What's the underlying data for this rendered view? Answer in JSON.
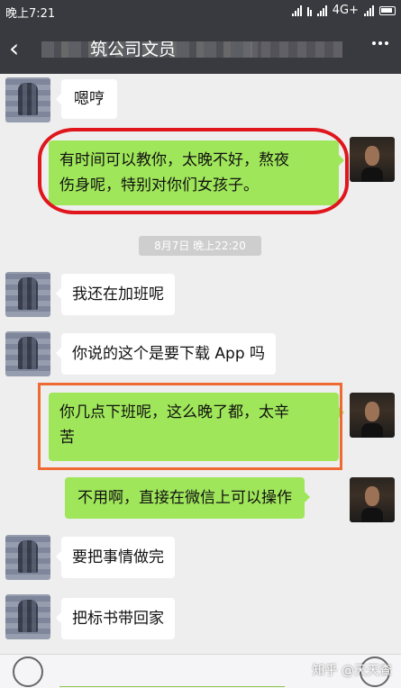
{
  "status_bar": {
    "time": "晚上7:21",
    "network": "4G+"
  },
  "nav": {
    "title": "筑公司文员",
    "back_icon": "chevron-left-icon",
    "more_icon": "more-icon"
  },
  "messages": [
    {
      "side": "in",
      "text": "嗯哼"
    },
    {
      "side": "out",
      "lines": [
        "有时间可以教你，太晚不好，熬夜",
        "伤身呢，特别对你们女孩子。"
      ]
    },
    {
      "side": "in",
      "text": "我还在加班呢"
    },
    {
      "side": "in",
      "text": "你说的这个是要下载 App 吗"
    },
    {
      "side": "out",
      "lines": [
        "你几点下班呢，这么晚了都，太辛",
        "苦"
      ]
    },
    {
      "side": "out",
      "text": "不用啊，直接在微信上可以操作"
    },
    {
      "side": "in",
      "text": "要把事情做完"
    },
    {
      "side": "in",
      "text": "把标书带回家"
    }
  ],
  "timestamp": "8月7日 晚上22:20",
  "watermark": "知乎 @天天查",
  "colors": {
    "bar": "#393a3f",
    "chat_bg": "#eeeeee",
    "out_bubble": "#9fe65a",
    "in_bubble": "#ffffff",
    "highlight_red": "#e0161d",
    "highlight_orange": "#ef6a33"
  }
}
